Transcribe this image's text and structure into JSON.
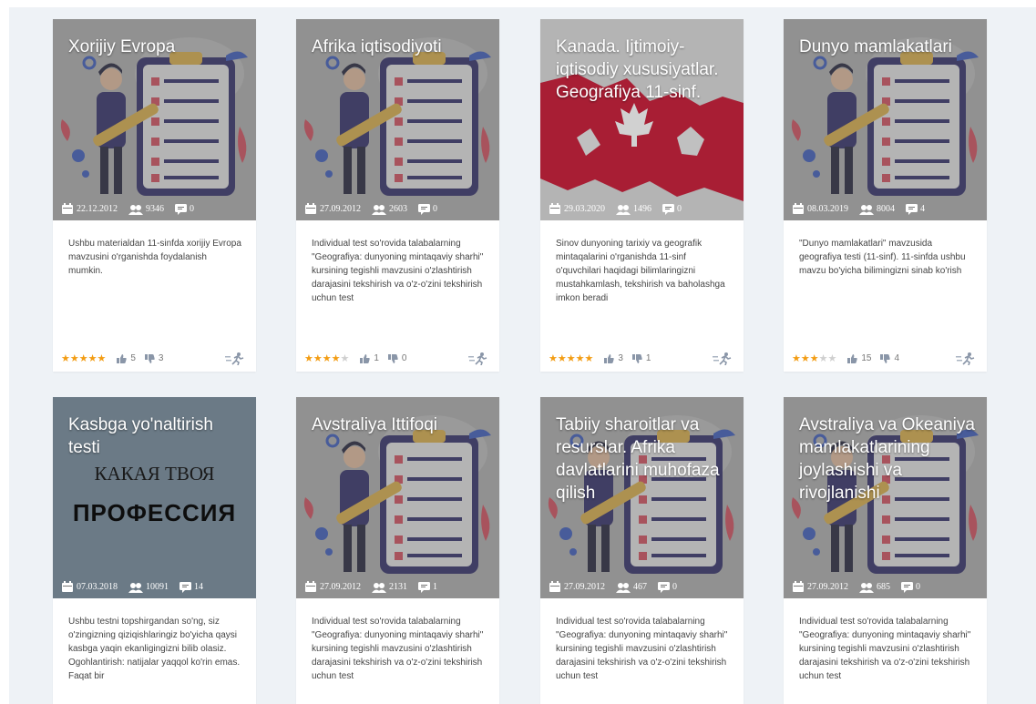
{
  "cards": [
    {
      "title": "Xorijiy Evropa",
      "date": "22.12.2012",
      "views": "9346",
      "comments": "0",
      "description": "Ushbu materialdan 11-sinfda xorijiy Evropa mavzusini o'rganishda foydalanish mumkin.",
      "rating": 5,
      "likes": "5",
      "dislikes": "3",
      "image": "checklist"
    },
    {
      "title": "Afrika iqtisodiyoti",
      "date": "27.09.2012",
      "views": "2603",
      "comments": "0",
      "description": "Individual test so'rovida talabalarning \"Geografiya: dunyoning mintaqaviy sharhi\" kursining tegishli mavzusini o'zlashtirish darajasini tekshirish va o'z-o'zini tekshirish uchun test",
      "rating": 4,
      "likes": "1",
      "dislikes": "0",
      "image": "checklist"
    },
    {
      "title": "Kanada. Ijtimoiy-iqtisodiy xususiyatlar. Geografiya 11-sinf.",
      "date": "29.03.2020",
      "views": "1496",
      "comments": "0",
      "description": "Sinov dunyoning tarixiy va geografik mintaqalarini o'rganishda 11-sinf o'quvchilari haqidagi bilimlaringizni mustahkamlash, tekshirish va baholashga imkon beradi",
      "rating": 5,
      "likes": "3",
      "dislikes": "1",
      "image": "canada"
    },
    {
      "title": "Dunyo mamlakatlari",
      "date": "08.03.2019",
      "views": "8004",
      "comments": "4",
      "description": "\"Dunyo mamlakatlari\" mavzusida geografiya testi (11-sinf). 11-sinfda ushbu mavzu bo'yicha bilimingizni sinab ko'rish",
      "rating": 3,
      "likes": "15",
      "dislikes": "4",
      "image": "checklist"
    },
    {
      "title": "Kasbga yo'naltirish testi",
      "date": "07.03.2018",
      "views": "10091",
      "comments": "14",
      "description": "Ushbu testni topshirgandan so'ng, siz o'zingizning qiziqishlaringiz bo'yicha qaysi kasbga yaqin ekanligingizni bilib olasiz. Ogohlantirish: natijalar yaqqol ko'rin emas. Faqat bir",
      "image": "profession",
      "image_text_1": "КАКАЯ ТВОЯ",
      "image_text_2": "ПРОФЕССИЯ"
    },
    {
      "title": "Avstraliya Ittifoqi",
      "date": "27.09.2012",
      "views": "2131",
      "comments": "1",
      "description": "Individual test so'rovida talabalarning \"Geografiya: dunyoning mintaqaviy sharhi\" kursining tegishli mavzusini o'zlashtirish darajasini tekshirish va o'z-o'zini tekshirish uchun test",
      "image": "checklist"
    },
    {
      "title": "Tabiiy sharoitlar va resurslar. Afrika davlatlarini muhofaza qilish",
      "date": "27.09.2012",
      "views": "467",
      "comments": "0",
      "description": "Individual test so'rovida talabalarning \"Geografiya: dunyoning mintaqaviy sharhi\" kursining tegishli mavzusini o'zlashtirish darajasini tekshirish va o'z-o'zini tekshirish uchun test",
      "image": "checklist"
    },
    {
      "title": "Avstraliya va Okeaniya mamlakatlarining joylashishi va rivojlanishi",
      "date": "27.09.2012",
      "views": "685",
      "comments": "0",
      "description": "Individual test so'rovida talabalarning \"Geografiya: dunyoning mintaqaviy sharhi\" kursining tegishli mavzusini o'zlashtirish darajasini tekshirish va o'z-o'zini tekshirish uchun test",
      "image": "checklist"
    }
  ],
  "icons": {
    "date": "calendar-icon",
    "views": "users-icon",
    "comments": "comment-icon",
    "likes": "thumbs-up-icon",
    "dislikes": "thumbs-down-icon",
    "action": "run-test-icon"
  },
  "colors": {
    "star": "#f39c12",
    "star_off": "#cfcfcf",
    "card_overlay": "#8a8a8a",
    "page_bg": "#eef2f6"
  }
}
